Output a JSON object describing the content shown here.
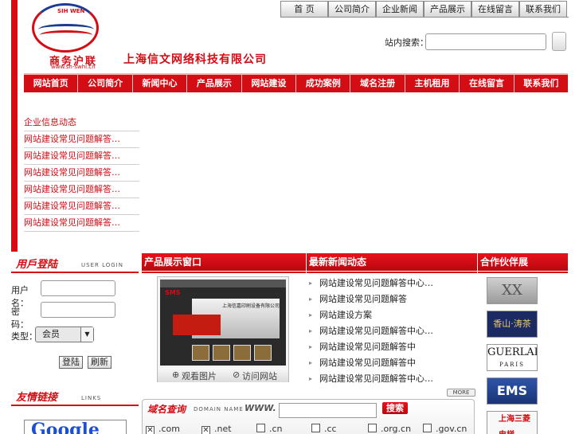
{
  "header": {
    "logo_arc_text": "SIH WEN",
    "logo_cn": "商务沪联",
    "logo_url": "www.sh-swhl.cn",
    "company_name": "上海信文网络科技有限公司",
    "search_label": "站内搜索：",
    "search_value": ""
  },
  "top_nav": [
    "首 页",
    "公司简介",
    "企业新闻",
    "产品展示",
    "在线留言",
    "联系我们"
  ],
  "main_nav": [
    "网站首页",
    "公司简介",
    "新闻中心",
    "产品展示",
    "网站建设",
    "成功案例",
    "域名注册",
    "主机租用",
    "在线留言",
    "联系我们"
  ],
  "news_list": [
    "企业信息动态",
    "网站建设常见问题解答…",
    "网站建设常见问题解答…",
    "网站建设常见问题解答…",
    "网站建设常见问题解答…",
    "网站建设常见问题解答…",
    "网站建设常见问题解答…"
  ],
  "sections": {
    "products": "产品展示窗口",
    "latest": "最新新闻动态",
    "brands": "合作伙伴展"
  },
  "login": {
    "title_cn": "用戶登陆",
    "title_en": "USER LOGIN",
    "username_label": "用户名：",
    "password_label": "密　码：",
    "type_label": "类型：",
    "type_value": "会员",
    "login_button": "登陆",
    "reset_button": "刷新"
  },
  "links": {
    "title_cn": "友情链接",
    "title_en": "LINKS",
    "google": "Google"
  },
  "product": {
    "logo_text": "SMS",
    "caption": "上海信嘉印刷设备有限公司",
    "view_pic": "观看图片",
    "visit_site": "访问网站"
  },
  "latest_list": [
    "网站建设常见问题解答中心…",
    "网站建设常见问题解答",
    "网站建设方案",
    "网站建设常见问题解答中心…",
    "网站建设常见问题解答中",
    "网站建设常见问题解答中",
    "网站建设常见问题解答中心…"
  ],
  "more_label": "MORE",
  "brands": {
    "b1": "XX",
    "b2": "香山·涛茶",
    "b3_main": "GUERLAIN",
    "b3_sub": "PARIS",
    "b4": "EMS",
    "b5": "上海三菱电梯"
  },
  "domain": {
    "title": "域名查询",
    "title_en": "DOMAIN NAME",
    "www": "WWW.",
    "input_value": "",
    "search_button": "搜索",
    "tlds": [
      {
        "label": ".com",
        "checked": true
      },
      {
        "label": ".net",
        "checked": true
      },
      {
        "label": ".cn",
        "checked": false
      },
      {
        "label": ".cc",
        "checked": false
      },
      {
        "label": ".org.cn",
        "checked": false
      },
      {
        "label": ".gov.cn",
        "checked": false
      }
    ]
  },
  "colors": {
    "brand_red": "#d40c14",
    "brand_blue": "#1c3c92"
  }
}
